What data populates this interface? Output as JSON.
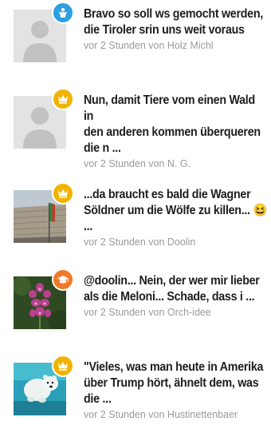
{
  "comments": [
    {
      "headline": "Bravo so soll ws gemocht werden,\ndie Tiroler srin uns weit voraus",
      "meta": "vor 2 Stunden von Holz Michl",
      "avatar": "default-avatar",
      "badge": {
        "icon": "presenter-icon",
        "color": "#2b9fe0"
      }
    },
    {
      "headline": "Nun, damit Tiere vom einen Wald in\nden anderen kommen überqueren\ndie n ...",
      "meta": "vor 2 Stunden von N. G.",
      "avatar": "default-avatar",
      "badge": {
        "icon": "crown-icon",
        "color": "#f2b300"
      }
    },
    {
      "headline": "...da braucht es bald die Wagner\nSöldner um die Wölfe zu killen... 😆\n...",
      "meta": "vor 2 Stunden von Doolin",
      "avatar": "flag-wall-photo",
      "badge": {
        "icon": "crown-icon",
        "color": "#f2b300"
      }
    },
    {
      "headline": "@doolin... Nein, der wer mir lieber\nals die Meloni... Schade, dass i ...",
      "meta": "vor 2 Stunden von Orch-idee",
      "avatar": "orchid-photo",
      "badge": {
        "icon": "graduation-cap-icon",
        "color": "#f07a28"
      }
    },
    {
      "headline": "\"Vieles, was man heute in Amerika\nüber Trump hört, ähnelt dem, was\ndie ...",
      "meta": "vor 2 Stunden von Hustinettenbaer",
      "avatar": "polar-bear-photo",
      "badge": {
        "icon": "crown-icon",
        "color": "#f2b300"
      }
    }
  ]
}
